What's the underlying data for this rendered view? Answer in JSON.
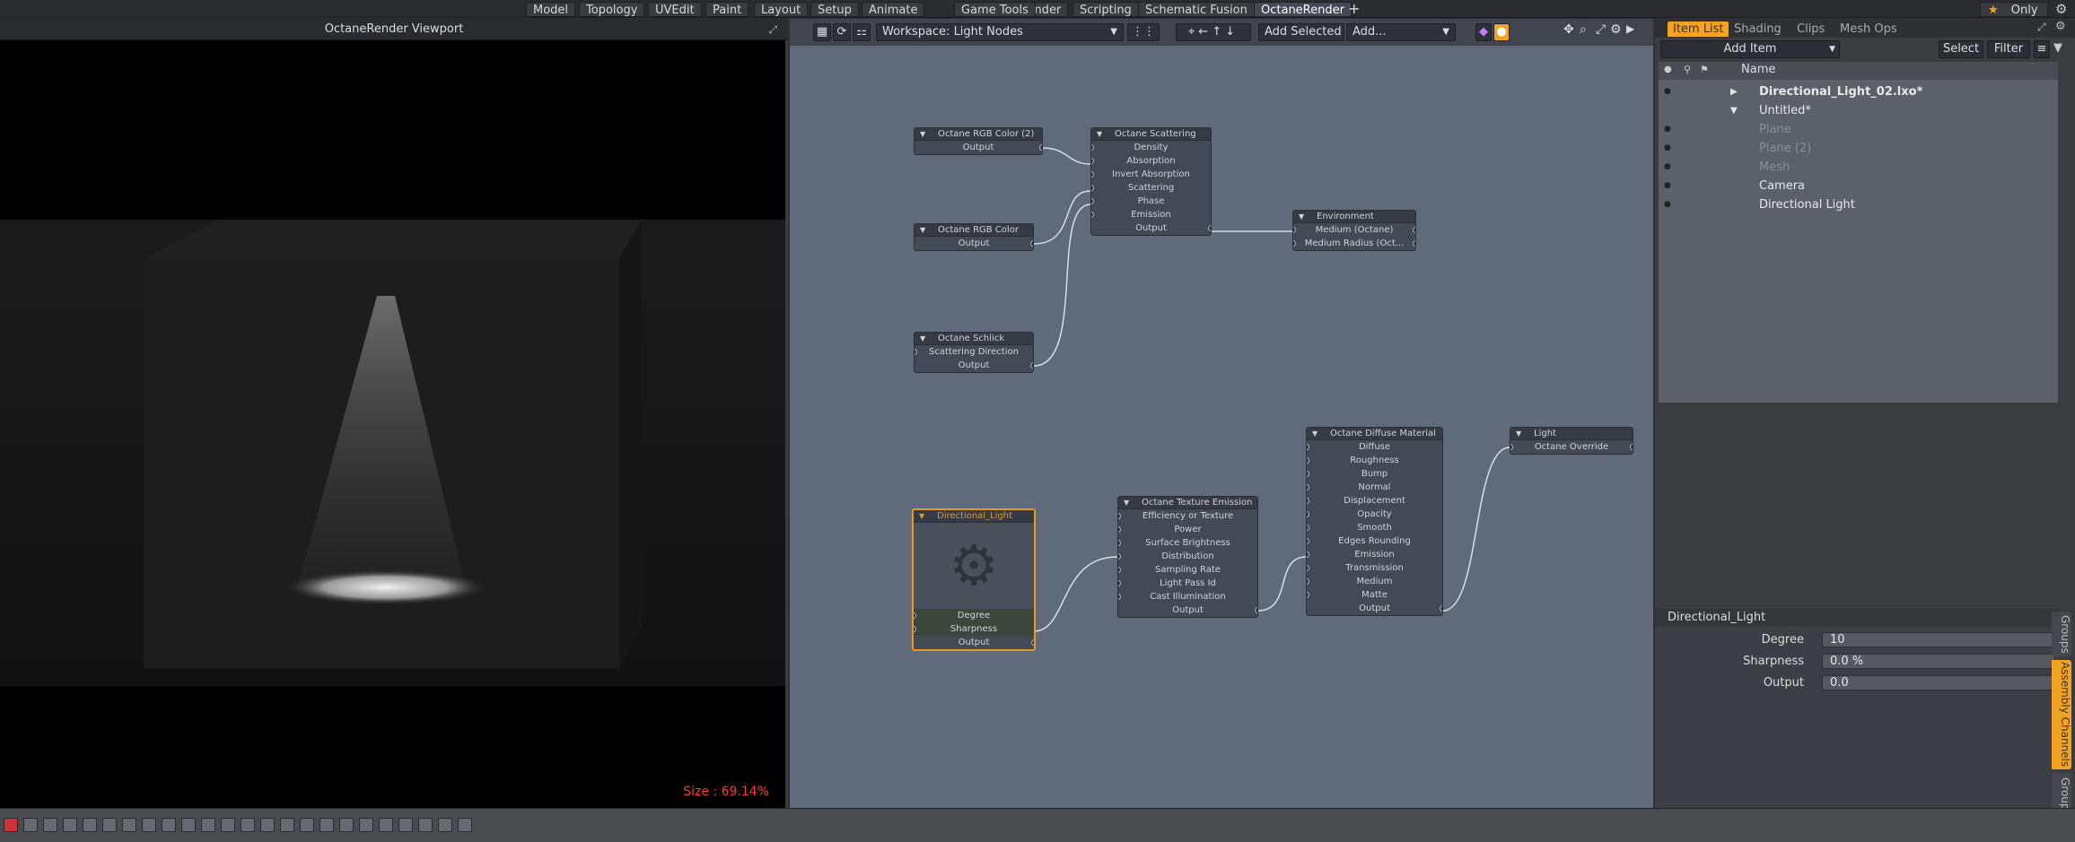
{
  "top_tabs": [
    "Model",
    "Topology",
    "UVEdit",
    "Paint",
    "Layout",
    "Setup",
    "Animate",
    "Render",
    "Scripting",
    "Game Tools",
    "Schematic Fusion",
    "OctaneRender"
  ],
  "top_active": "OctaneRender",
  "top_plus": "+",
  "only_label": "Only",
  "viewport": {
    "title": "OctaneRender Viewport",
    "size_label": "Size : 69.14%"
  },
  "node_editor": {
    "workspace": "Workspace: Light Nodes",
    "add_selected": "Add Selected",
    "add": "Add...",
    "nodes": {
      "rgb2": {
        "title": "Octane RGB Color (2)",
        "rows": [
          "Output"
        ]
      },
      "scattering": {
        "title": "Octane Scattering",
        "rows": [
          "Density",
          "Absorption",
          "Invert Absorption",
          "Scattering",
          "Phase",
          "Emission",
          "Output"
        ]
      },
      "environment": {
        "title": "Environment",
        "rows": [
          "Medium (Octane)",
          "Medium Radius (Oct..."
        ]
      },
      "rgb": {
        "title": "Octane RGB Color",
        "rows": [
          "Output"
        ]
      },
      "schlick": {
        "title": "Octane Schlick",
        "rows": [
          "Scattering Direction",
          "Output"
        ]
      },
      "dirlight": {
        "title": "Directional_Light",
        "rows": [
          "Degree",
          "Sharpness",
          "Output"
        ]
      },
      "texemission": {
        "title": "Octane Texture Emission",
        "rows": [
          "Efficiency or Texture",
          "Power",
          "Surface Brightness",
          "Distribution",
          "Sampling Rate",
          "Light Pass Id",
          "Cast Illumination",
          "Output"
        ]
      },
      "diffuse": {
        "title": "Octane Diffuse Material",
        "rows": [
          "Diffuse",
          "Roughness",
          "Bump",
          "Normal",
          "Displacement",
          "Opacity",
          "Smooth",
          "Edges Rounding",
          "Emission",
          "Transmission",
          "Medium",
          "Matte",
          "Output"
        ]
      },
      "light": {
        "title": "Light",
        "rows": [
          "Octane Override"
        ]
      }
    }
  },
  "side": {
    "tabs": [
      "Item List",
      "Shading",
      "Clips",
      "Mesh Ops"
    ],
    "active_tab": "Item List",
    "add_item": "Add Item",
    "select": "Select",
    "filter": "Filter",
    "column_name": "Name",
    "items": [
      {
        "name": "Directional_Light_02.lxo*",
        "bold": true,
        "dim": false
      },
      {
        "name": "Untitled*",
        "bold": false,
        "dim": false
      },
      {
        "name": "Plane",
        "bold": false,
        "dim": true
      },
      {
        "name": "Plane (2)",
        "bold": false,
        "dim": true
      },
      {
        "name": "Mesh",
        "bold": false,
        "dim": true
      },
      {
        "name": "Camera",
        "bold": false,
        "dim": false
      },
      {
        "name": "Directional Light",
        "bold": false,
        "dim": false
      }
    ],
    "props_title": "Directional_Light",
    "props": [
      {
        "label": "Degree",
        "value": "10"
      },
      {
        "label": "Sharpness",
        "value": "0.0 %"
      },
      {
        "label": "Output",
        "value": "0.0"
      }
    ],
    "vtabs": [
      "Groups",
      "Assembly Channels",
      "Group Disp"
    ]
  },
  "colors": {
    "accent": "#f2a321",
    "size_label": "#ff3535"
  }
}
